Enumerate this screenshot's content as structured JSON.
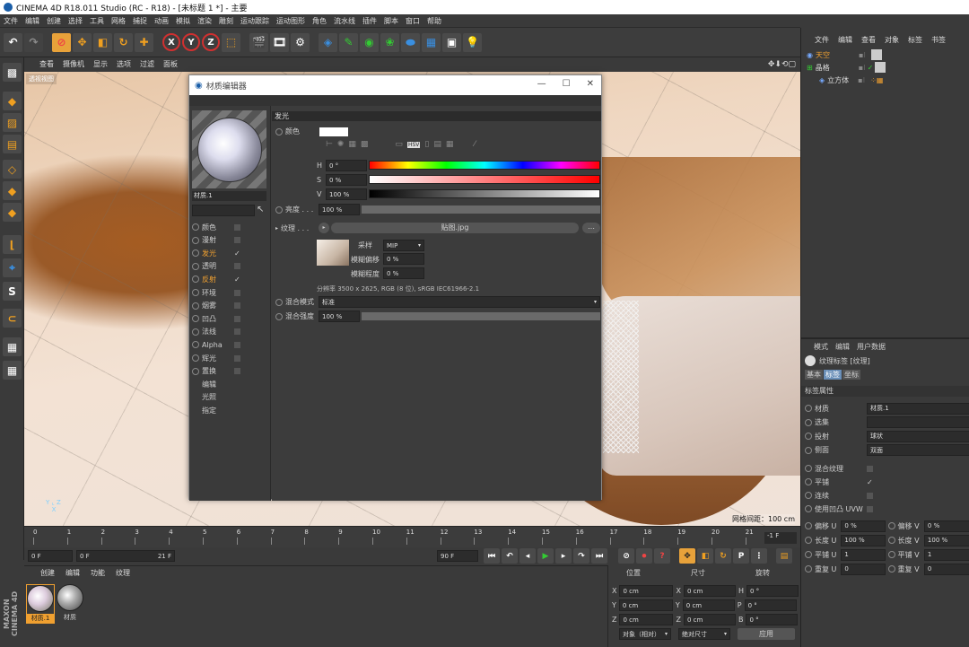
{
  "title": "CINEMA 4D R18.011 Studio (RC - R18) - [未标题 1 *] - 主要",
  "menu": [
    "文件",
    "编辑",
    "创建",
    "选择",
    "工具",
    "网格",
    "捕捉",
    "动画",
    "模拟",
    "渲染",
    "雕刻",
    "运动跟踪",
    "运动图形",
    "角色",
    "流水线",
    "插件",
    "脚本",
    "窗口",
    "帮助"
  ],
  "viewport": {
    "menu": [
      "查看",
      "摄像机",
      "显示",
      "选项",
      "过滤",
      "面板"
    ],
    "camera_label": "透视视图",
    "grid_label": "网格间距：100 cm"
  },
  "timeline": {
    "ticks": [
      "0",
      "1",
      "2",
      "3",
      "4",
      "5",
      "6",
      "7",
      "8",
      "9",
      "10",
      "11",
      "12",
      "13",
      "14",
      "15",
      "16",
      "17",
      "18",
      "19",
      "20",
      "21"
    ],
    "frame_field": "-1 F"
  },
  "playback": {
    "start": "0 F",
    "range_start": "0 F",
    "range_end": "21 F",
    "end": "90 F"
  },
  "material_manager": {
    "menu": [
      "创建",
      "编辑",
      "功能",
      "纹理"
    ],
    "materials": [
      "材质.1",
      "材质"
    ]
  },
  "coords": {
    "headers": [
      "位置",
      "尺寸",
      "旋转"
    ],
    "rows": [
      {
        "axis": "X",
        "pos": "0 cm",
        "sizeaxis": "X",
        "size": "0 cm",
        "rotaxis": "H",
        "rot": "0 °"
      },
      {
        "axis": "Y",
        "pos": "0 cm",
        "sizeaxis": "Y",
        "size": "0 cm",
        "rotaxis": "P",
        "rot": "0 °"
      },
      {
        "axis": "Z",
        "pos": "0 cm",
        "sizeaxis": "Z",
        "size": "0 cm",
        "rotaxis": "B",
        "rot": "0 °"
      }
    ],
    "mode": "对象（相对）",
    "size_mode": "绝对尺寸",
    "apply": "应用"
  },
  "object_manager": {
    "menu": [
      "文件",
      "编辑",
      "查看",
      "对象",
      "标签",
      "书签"
    ],
    "objects": [
      "天空",
      "晶格",
      "立方体"
    ]
  },
  "attribute_manager": {
    "menu": [
      "模式",
      "编辑",
      "用户数据"
    ],
    "tag_title": "纹理标签 [纹理]",
    "tabs": [
      "基本",
      "标签",
      "坐标"
    ],
    "section": "标签属性",
    "rows": [
      {
        "label": "材质",
        "value": "材质.1"
      },
      {
        "label": "选集",
        "value": ""
      },
      {
        "label": "投射",
        "value": "球状"
      },
      {
        "label": "侧面",
        "value": "双面"
      }
    ],
    "checks": [
      "混合纹理",
      "平铺",
      "连续",
      "使用凹凸 UVW"
    ],
    "uv": [
      {
        "l1": "偏移 U",
        "v1": "0 %",
        "l2": "偏移 V",
        "v2": "0 %"
      },
      {
        "l1": "长度 U",
        "v1": "100 %",
        "l2": "长度 V",
        "v2": "100 %"
      },
      {
        "l1": "平铺 U",
        "v1": "1",
        "l2": "平铺 V",
        "v2": "1"
      },
      {
        "l1": "重复 U",
        "v1": "0",
        "l2": "重复 V",
        "v2": "0"
      }
    ]
  },
  "dialog": {
    "title": "材质编辑器",
    "material_name": "材质.1",
    "channels": [
      {
        "name": "颜色",
        "on": false
      },
      {
        "name": "漫射",
        "on": false
      },
      {
        "name": "发光",
        "on": true
      },
      {
        "name": "透明",
        "on": false
      },
      {
        "name": "反射",
        "on": true
      },
      {
        "name": "环境",
        "on": false
      },
      {
        "name": "烟雾",
        "on": false
      },
      {
        "name": "凹凸",
        "on": false
      },
      {
        "name": "法线",
        "on": false
      },
      {
        "name": "Alpha",
        "on": false
      },
      {
        "name": "辉光",
        "on": false
      },
      {
        "name": "置换",
        "on": false
      }
    ],
    "extras": [
      "编辑",
      "光照",
      "指定"
    ],
    "section": "发光",
    "color_label": "颜色",
    "h_label": "H",
    "h": "0 °",
    "s_label": "S",
    "s": "0 %",
    "v_label": "V",
    "v": "100 %",
    "brightness_label": "亮度 . . .",
    "brightness": "100 %",
    "texture_label": "纹理 . . .",
    "texture_file": "贴图.jpg",
    "sampling_label": "采样",
    "sampling": "MIP",
    "blur_offset_label": "模糊偏移",
    "blur_offset": "0 %",
    "blur_scale_label": "模糊程度",
    "blur_scale": "0 %",
    "resolution": "分辨率 3500 x 2625, RGB (8 位), sRGB IEC61966-2.1",
    "blend_mode_label": "混合模式",
    "blend_mode": "标准",
    "blend_strength_label": "混合强度",
    "blend_strength": "100 %",
    "hsv_mode": "HSV"
  }
}
